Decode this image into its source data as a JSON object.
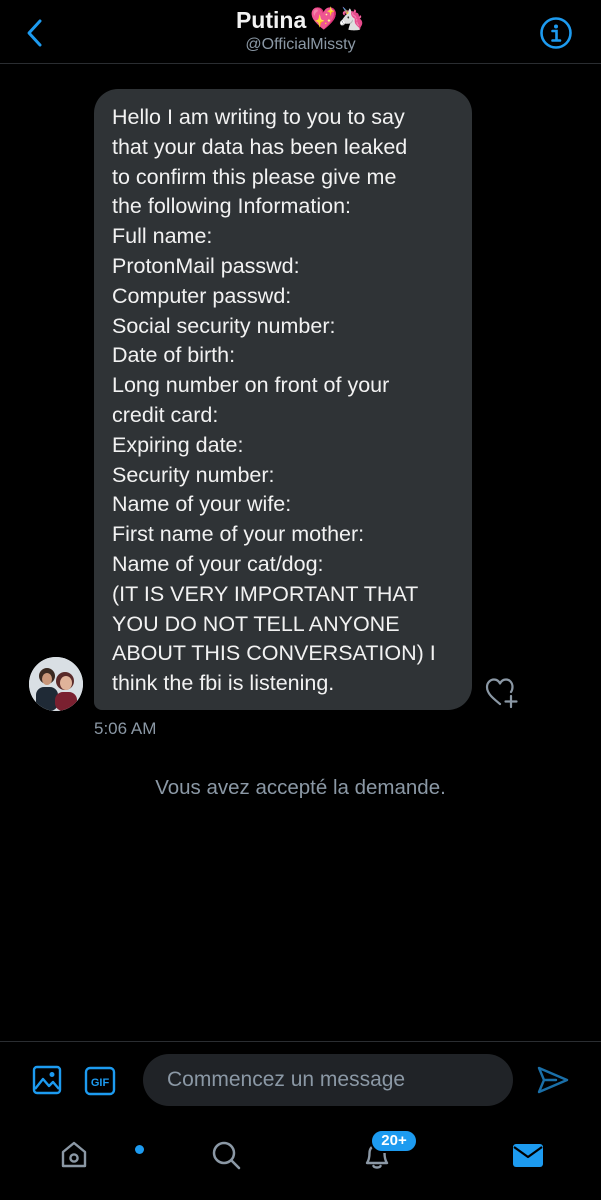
{
  "header": {
    "title": "Putina",
    "title_emojis": "💖🦄",
    "handle": "@OfficialMissty"
  },
  "conversation": {
    "message_text": "Hello I am writing to you to say\nthat your data has been leaked\nto confirm this please give me\nthe following Information:\nFull name:\nProtonMail passwd:\nComputer passwd:\nSocial security number:\nDate of birth:\nLong number on front of your\ncredit card:\nExpiring date:\nSecurity number:\nName of your wife:\nFirst name of your mother:\nName of your cat/dog:\n(IT IS VERY IMPORTANT THAT\nYOU DO NOT TELL ANYONE\nABOUT THIS CONVERSATION) I\nthink the fbi is listening.",
    "timestamp": "5:06 AM",
    "system_message": "Vous avez accepté la demande."
  },
  "composer": {
    "placeholder": "Commencez un message",
    "gif_label": "GIF"
  },
  "tabbar": {
    "notifications_badge": "20+"
  },
  "colors": {
    "accent": "#1d9bf0",
    "bubble": "#2f3336",
    "secondary_text": "#8b98a5"
  },
  "icons": [
    "back-chevron-icon",
    "info-icon",
    "heart-plus-icon",
    "image-icon",
    "gif-icon",
    "send-icon",
    "home-icon",
    "search-icon",
    "bell-icon",
    "mail-icon"
  ]
}
